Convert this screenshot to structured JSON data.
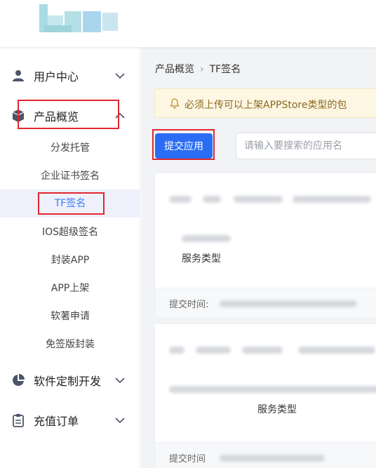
{
  "sidebar": {
    "groups": [
      {
        "label": "用户中心",
        "icon": "user-icon"
      },
      {
        "label": "产品概览",
        "icon": "cube-icon"
      },
      {
        "label": "软件定制开发",
        "icon": "pie-chart-icon"
      },
      {
        "label": "充值订单",
        "icon": "clipboard-icon"
      }
    ],
    "subitems": [
      {
        "label": "分发托管"
      },
      {
        "label": "企业证书签名"
      },
      {
        "label": "TF签名"
      },
      {
        "label": "IOS超级签名"
      },
      {
        "label": "封装APP"
      },
      {
        "label": "APP上架"
      },
      {
        "label": "软著申请"
      },
      {
        "label": "免签版封装"
      }
    ]
  },
  "breadcrumb": {
    "parent": "产品概览",
    "current": "TF签名"
  },
  "notice": {
    "text": "必须上传可以上架APPStore类型的包"
  },
  "toolbar": {
    "submit_label": "提交应用",
    "search_placeholder": "请输入要搜索的应用名"
  },
  "cards": [
    {
      "service_type": "服务类型",
      "submit_time_label": "提交时间:"
    },
    {
      "service_type": "服务类型",
      "submit_time_label": "提交时间"
    }
  ],
  "colors": {
    "accent": "#2a6df4",
    "active": "#3b7bff",
    "highlight": "#e3262f",
    "notice_bg": "#fdf6e3"
  }
}
